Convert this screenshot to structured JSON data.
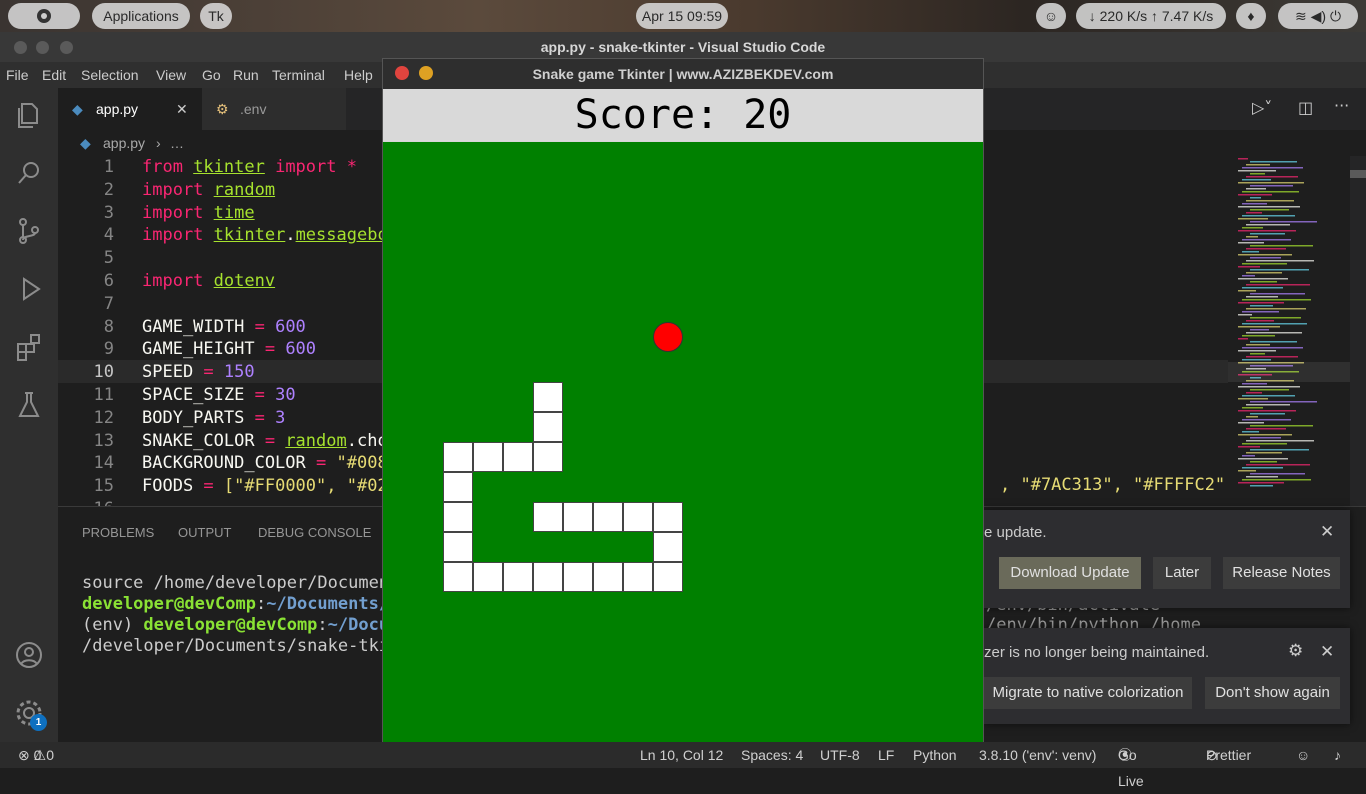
{
  "topbar": {
    "apps_label": "Applications",
    "tk_label": "Tk",
    "date": "Apr 15",
    "time": "09:59",
    "network": "↓ 220 K/s ↑ 7.47 K/s"
  },
  "window_title": "app.py - snake-tkinter - Visual Studio Code",
  "menu": [
    "File",
    "Edit",
    "Selection",
    "View",
    "Go",
    "Run",
    "Terminal",
    "Help"
  ],
  "tabs": [
    {
      "label": "app.py",
      "active": true
    },
    {
      "label": ".env",
      "active": false
    }
  ],
  "breadcrumb": {
    "file": "app.py",
    "rest": "…"
  },
  "editor": {
    "lines": [
      {
        "n": "1",
        "tokens": [
          [
            "from ",
            "kw"
          ],
          [
            "tkinter",
            "mod"
          ],
          [
            " import ",
            "kw"
          ],
          [
            "*",
            "kw"
          ]
        ]
      },
      {
        "n": "2",
        "tokens": [
          [
            "import ",
            "kw"
          ],
          [
            "random",
            "mod"
          ]
        ]
      },
      {
        "n": "3",
        "tokens": [
          [
            "import ",
            "kw"
          ],
          [
            "time",
            "mod"
          ]
        ]
      },
      {
        "n": "4",
        "tokens": [
          [
            "import ",
            "kw"
          ],
          [
            "tkinter",
            "mod"
          ],
          [
            ".",
            "plain"
          ],
          [
            "messagebox",
            "mod"
          ]
        ]
      },
      {
        "n": "5",
        "tokens": []
      },
      {
        "n": "6",
        "tokens": [
          [
            "import ",
            "kw"
          ],
          [
            "dotenv",
            "mod"
          ]
        ]
      },
      {
        "n": "7",
        "tokens": []
      },
      {
        "n": "8",
        "tokens": [
          [
            "GAME_WIDTH ",
            "plain"
          ],
          [
            "= ",
            "kw"
          ],
          [
            "600",
            "num"
          ]
        ]
      },
      {
        "n": "9",
        "tokens": [
          [
            "GAME_HEIGHT ",
            "plain"
          ],
          [
            "= ",
            "kw"
          ],
          [
            "600",
            "num"
          ]
        ]
      },
      {
        "n": "10",
        "tokens": [
          [
            "SPEED ",
            "plain"
          ],
          [
            "= ",
            "kw"
          ],
          [
            "150",
            "num"
          ]
        ]
      },
      {
        "n": "11",
        "tokens": [
          [
            "SPACE_SIZE ",
            "plain"
          ],
          [
            "= ",
            "kw"
          ],
          [
            "30",
            "num"
          ]
        ]
      },
      {
        "n": "12",
        "tokens": [
          [
            "BODY_PARTS ",
            "plain"
          ],
          [
            "= ",
            "kw"
          ],
          [
            "3",
            "num"
          ]
        ]
      },
      {
        "n": "13",
        "tokens": [
          [
            "SNAKE_COLOR ",
            "plain"
          ],
          [
            "= ",
            "kw"
          ],
          [
            "random",
            "mod"
          ],
          [
            ".cho",
            "plain"
          ]
        ]
      },
      {
        "n": "14",
        "tokens": [
          [
            "BACKGROUND_COLOR ",
            "plain"
          ],
          [
            "= ",
            "kw"
          ],
          [
            "\"#008",
            "str"
          ]
        ]
      },
      {
        "n": "15",
        "tokens": [
          [
            "FOODS ",
            "plain"
          ],
          [
            "= ",
            "kw"
          ],
          [
            "[\"#FF0000\", \"#02",
            "str"
          ]
        ]
      },
      {
        "n": "16",
        "tokens": []
      }
    ],
    "line15_tail": ", \"#7AC313\", \"#FFFFC2\"]"
  },
  "panel": {
    "tabs": [
      "PROBLEMS",
      "OUTPUT",
      "DEBUG CONSOLE"
    ],
    "terminal": [
      {
        "parts": [
          [
            "source /home/developer/Documen",
            "plain"
          ]
        ]
      },
      {
        "parts": [
          [
            "developer@devComp",
            "user"
          ],
          [
            ":",
            "plain"
          ],
          [
            "~/Documents/",
            "path"
          ]
        ]
      },
      {
        "parts": [
          [
            "(env) ",
            "plain"
          ],
          [
            "developer@devComp",
            "user"
          ],
          [
            ":",
            "plain"
          ],
          [
            "~/Docu",
            "path"
          ]
        ]
      },
      {
        "parts": [
          [
            "/developer/Documents/snake-tki",
            "plain"
          ]
        ]
      }
    ],
    "terminal_right": [
      "/env/bin/activate",
      "/env/bin/python /home"
    ]
  },
  "notifications": {
    "update": {
      "message": "e update.",
      "buttons": [
        "Download Update",
        "Later",
        "Release Notes"
      ]
    },
    "colorizer": {
      "message": "zer is no longer being maintained.",
      "buttons": [
        "Migrate to native colorization",
        "Don't show again"
      ]
    }
  },
  "status": {
    "errors": "0",
    "warnings": "0",
    "position": "Ln 10, Col 12",
    "spaces": "Spaces: 4",
    "encoding": "UTF-8",
    "eol": "LF",
    "language": "Python",
    "interpreter": "3.8.10 ('env': venv)",
    "golive": "Go Live",
    "prettier": "Prettier"
  },
  "settings_badge": "1",
  "game": {
    "title": "Snake game Tkinter | www.AZIZBEKDEV.com",
    "score_label": "Score: 20",
    "grid_cells": 20,
    "background": "#008000",
    "snake_color": "#FFFFFF",
    "food_color": "#FF0000",
    "food": {
      "col": 9,
      "row": 6
    },
    "snake": [
      {
        "col": 5,
        "row": 8
      },
      {
        "col": 5,
        "row": 9
      },
      {
        "col": 5,
        "row": 10
      },
      {
        "col": 4,
        "row": 10
      },
      {
        "col": 3,
        "row": 10
      },
      {
        "col": 2,
        "row": 10
      },
      {
        "col": 2,
        "row": 11
      },
      {
        "col": 2,
        "row": 12
      },
      {
        "col": 2,
        "row": 13
      },
      {
        "col": 2,
        "row": 14
      },
      {
        "col": 3,
        "row": 14
      },
      {
        "col": 4,
        "row": 14
      },
      {
        "col": 5,
        "row": 14
      },
      {
        "col": 6,
        "row": 14
      },
      {
        "col": 7,
        "row": 14
      },
      {
        "col": 8,
        "row": 14
      },
      {
        "col": 9,
        "row": 14
      },
      {
        "col": 9,
        "row": 13
      },
      {
        "col": 9,
        "row": 12
      },
      {
        "col": 8,
        "row": 12
      },
      {
        "col": 7,
        "row": 12
      },
      {
        "col": 6,
        "row": 12
      },
      {
        "col": 5,
        "row": 12
      }
    ]
  }
}
